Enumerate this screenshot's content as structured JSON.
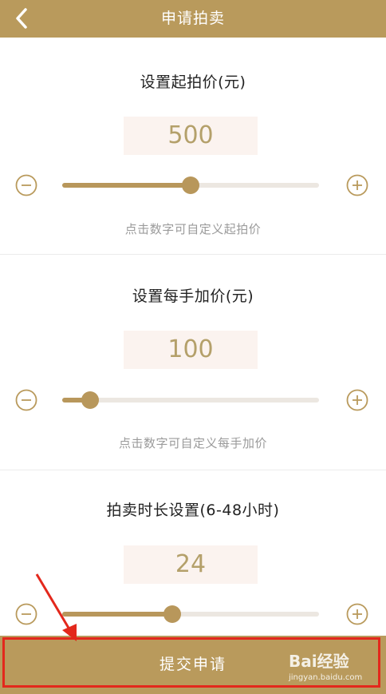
{
  "header": {
    "title": "申请拍卖"
  },
  "sections": [
    {
      "title": "设置起拍价(元)",
      "value": "500",
      "hint": "点击数字可自定义起拍价",
      "slider_fraction": 0.5
    },
    {
      "title": "设置每手加价(元)",
      "value": "100",
      "hint": "点击数字可自定义每手加价",
      "slider_fraction": 0.11
    },
    {
      "title": "拍卖时长设置(6-48小时)",
      "value": "24",
      "hint": "",
      "slider_fraction": 0.43
    }
  ],
  "submit": {
    "label": "提交申请"
  },
  "watermark": {
    "brand": "Bai经验",
    "url": "jingyan.baidu.com"
  },
  "colors": {
    "accent": "#b99a5c",
    "value_text": "#b4a06a",
    "value_bg": "#fbf3ef",
    "annotation": "#e3281c"
  },
  "icons": {
    "back": "chevron-left-icon",
    "minus": "minus-circle-icon",
    "plus": "plus-circle-icon"
  }
}
